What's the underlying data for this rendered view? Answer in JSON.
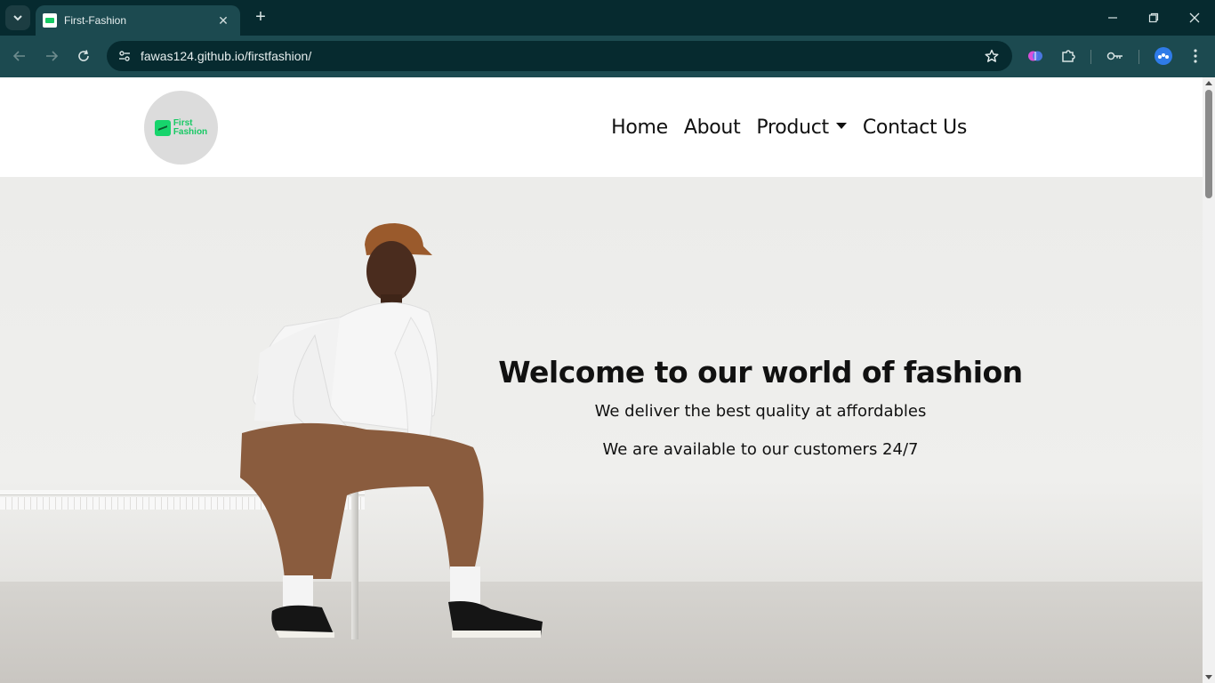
{
  "browser": {
    "tab_title": "First-Fashion",
    "url": "fawas124.github.io/firstfashion/",
    "icons": [
      "tab-search-icon",
      "close-icon",
      "plus-icon",
      "minimize-icon",
      "restore-icon",
      "window-close-icon",
      "back-arrow-icon",
      "forward-arrow-icon",
      "reload-icon",
      "site-info-icon",
      "star-icon",
      "extension-brain-icon",
      "puzzle-icon",
      "key-icon",
      "profile-icon",
      "more-vert-icon"
    ]
  },
  "site": {
    "logo_text_line1": "First",
    "logo_text_line2": "Fashion",
    "nav": {
      "home": "Home",
      "about": "About",
      "product": "Product",
      "contact": "Contact Us"
    },
    "hero": {
      "title": "Welcome to our world of fashion",
      "line1": "We deliver the best quality at affordables",
      "line2": "We are available to our customers 24/7"
    }
  },
  "colors": {
    "chrome_dark": "#062a2f",
    "chrome_toolbar": "#1c4a50",
    "logo_green": "#17c964"
  }
}
